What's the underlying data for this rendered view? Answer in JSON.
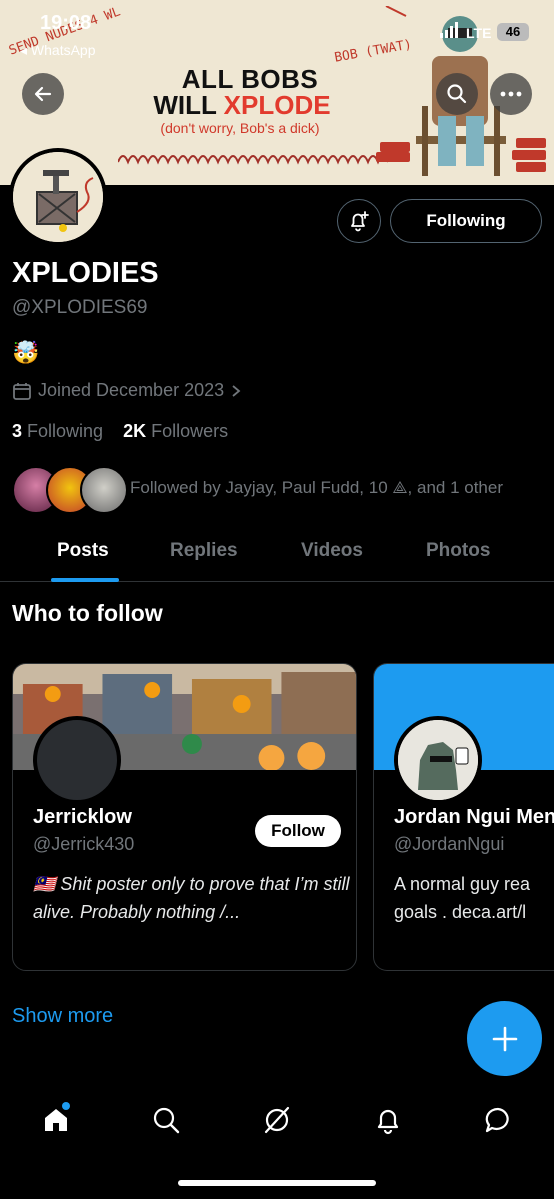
{
  "status_bar": {
    "time": "19:08",
    "back_app": "◂ WhatsApp",
    "network": "LTE",
    "battery": "46"
  },
  "banner": {
    "line1": "ALL BOBS",
    "line2_prefix": "WILL ",
    "line2_highlight": "XPLODE",
    "subtitle": "(don't worry, Bob's a dick)",
    "scribble_left": "SEND NUDES 4 WL",
    "scribble_right": "BOB (TWAT)"
  },
  "profile": {
    "name": "XPLODIES",
    "handle": "@XPLODIES69",
    "emoji": "🤯",
    "joined": "Joined December 2023",
    "following_count": "3",
    "following_label": "Following",
    "followers_count": "2K",
    "followers_label": "Followers",
    "followed_by": "Followed by Jayjay, Paul Fudd, 10 ⟁, and 1 other",
    "following_button": "Following"
  },
  "tabs": [
    "Posts",
    "Replies",
    "Videos",
    "Photos"
  ],
  "who_to_follow": {
    "title": "Who to follow",
    "cards": [
      {
        "name": "Jerricklow",
        "handle": "@Jerrick430",
        "bio": "🇲🇾 Shit poster only to prove that I’m still alive. Probably nothing /...",
        "button": "Follow"
      },
      {
        "name": "Jordan Ngui Men",
        "handle": "@JordanNgui",
        "bio": "A normal guy rea goals . deca.art/l"
      }
    ],
    "show_more": "Show more"
  },
  "colors": {
    "accent": "#1d9bf0",
    "muted": "#71767b",
    "background": "#000000"
  },
  "icons": [
    "back-arrow-icon",
    "search-icon",
    "more-icon",
    "bell-plus-icon",
    "calendar-icon",
    "chevron-right-icon",
    "plus-icon",
    "home-icon",
    "explore-icon",
    "grok-icon",
    "notifications-icon",
    "messages-icon"
  ]
}
